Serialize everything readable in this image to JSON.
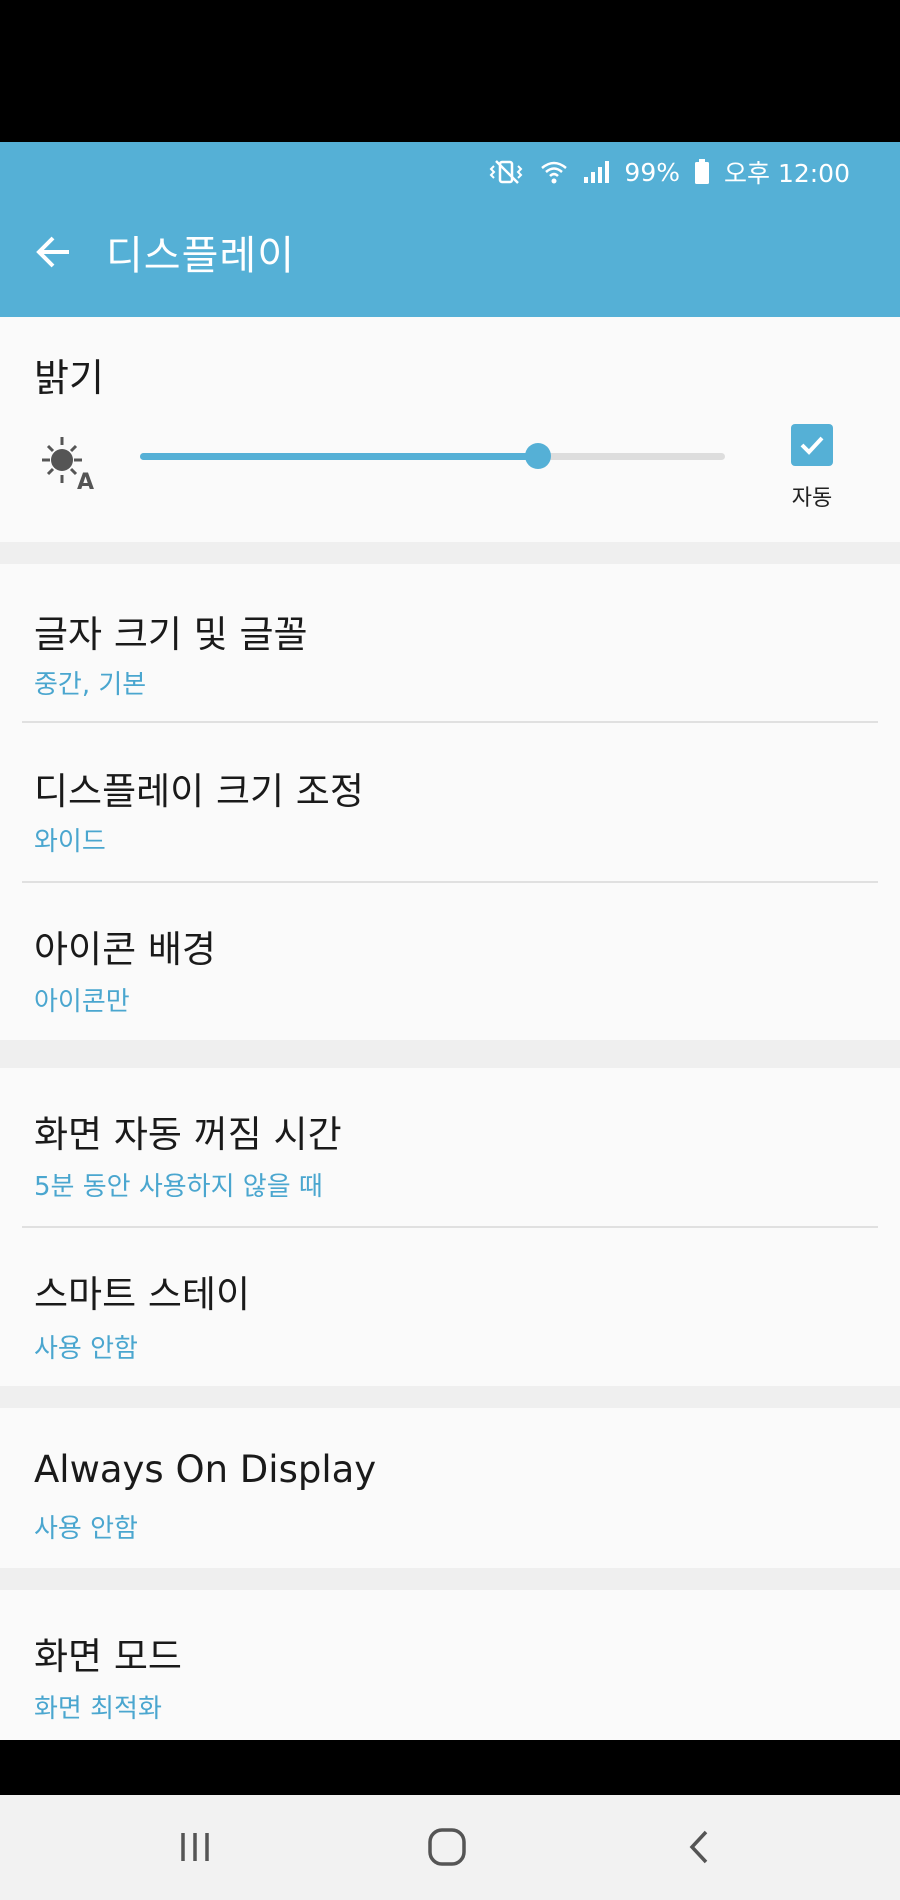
{
  "status": {
    "battery": "99%",
    "time": "오후 12:00",
    "icons": [
      "vibrate-mute-icon",
      "wifi-icon",
      "signal-icon",
      "battery-icon"
    ]
  },
  "header": {
    "title": "디스플레이"
  },
  "brightness": {
    "title": "밝기",
    "level_percent": 68,
    "auto_label": "자동",
    "auto_checked": true
  },
  "items": [
    {
      "title": "글자 크기 및 글꼴",
      "subtitle": "중간, 기본"
    },
    {
      "title": "디스플레이 크기 조정",
      "subtitle": "와이드"
    },
    {
      "title": "아이콘 배경",
      "subtitle": "아이콘만"
    },
    {
      "title": "화면 자동 꺼짐 시간",
      "subtitle": "5분 동안 사용하지 않을 때"
    },
    {
      "title": "스마트 스테이",
      "subtitle": "사용 안함"
    },
    {
      "title": "Always On Display",
      "subtitle": "사용 안함"
    },
    {
      "title": "화면 모드",
      "subtitle": "화면 최적화"
    }
  ],
  "colors": {
    "accent": "#55b0d6",
    "subtitle": "#4aa6cf",
    "background": "#efefef",
    "card": "#fafafa"
  }
}
